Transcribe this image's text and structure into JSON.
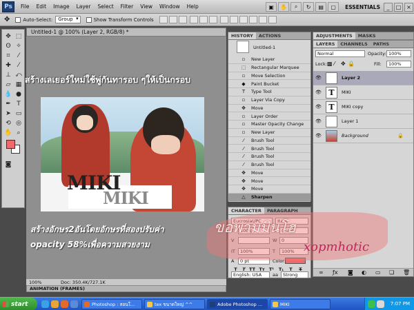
{
  "app": {
    "logo": "Ps",
    "menu": [
      "File",
      "Edit",
      "Image",
      "Layer",
      "Select",
      "Filter",
      "View",
      "Window",
      "Help"
    ],
    "workspace": "ESSENTIALS",
    "win_min": "_",
    "win_max": "□",
    "win_close": "×"
  },
  "options": {
    "auto_select_label": "Auto-Select:",
    "auto_select_value": "Group",
    "show_transform_label": "Show Transform Controls"
  },
  "document": {
    "tab_title": "Untitled-1 @ 100% (Layer 2, RGB/8) *",
    "zoom": "100%",
    "doc_size": "Doc: 350.4K/727.1K",
    "image_text_1": "MIKI",
    "image_text_2": "MIKI"
  },
  "animation_panel": {
    "tab_label": "ANIMATION (FRAMES)"
  },
  "history": {
    "tabs": [
      "HISTORY",
      "ACTIONS"
    ],
    "snapshot_label": "Untitled-1",
    "steps": [
      "New Layer",
      "Rectangular Marquee",
      "Move Selection",
      "Paint Bucket",
      "Type Tool",
      "Layer Via Copy",
      "Move",
      "Layer Order",
      "Master Opacity Change",
      "New Layer",
      "Brush Tool",
      "Brush Tool",
      "Brush Tool",
      "Brush Tool",
      "Move",
      "Move",
      "Move",
      "Sharpen"
    ],
    "selected_index": 17
  },
  "character": {
    "tabs": [
      "CHARACTER",
      "PARAGRAPH"
    ],
    "font_family": "EucrosiaUPC",
    "font_style": "Italic",
    "font_size": "100 pt",
    "leading": "(Auto)",
    "tracking": "0",
    "vertical_scale": "100%",
    "horizontal_scale": "100%",
    "baseline": "0 pt",
    "color_label": "Color:",
    "language": "English: USA",
    "antialias_label": "aa",
    "antialias": "Strong"
  },
  "adjustments": {
    "tabs": [
      "ADJUSTMENTS",
      "MASKS"
    ]
  },
  "layers": {
    "tabs": [
      "LAYERS",
      "CHANNELS",
      "PATHS"
    ],
    "blend_mode": "Normal",
    "opacity_label": "Opacity:",
    "opacity": "100%",
    "lock_label": "Lock:",
    "fill_label": "Fill:",
    "fill": "100%",
    "items": [
      {
        "name": "Layer 2",
        "thumb": "",
        "selected": true
      },
      {
        "name": "MIKI",
        "thumb": "T",
        "selected": false
      },
      {
        "name": "MIKI copy",
        "thumb": "T",
        "selected": false
      },
      {
        "name": "Layer 1",
        "thumb": "",
        "selected": false
      },
      {
        "name": "Background",
        "thumb": "",
        "selected": false
      }
    ]
  },
  "overlay": {
    "top_text": "สร้างเลเยอร์ใหม่ใช้พู่กันทารอบ ๆให้เป็นกรอบ",
    "mid_text_1": "สร้างอักษร2อันโดยอักษรที่สองปรับค่า",
    "mid_text_2": "opacity 58%เพื่อความสวยงาม",
    "watermark_thai": "ขอพามมินโฮ",
    "watermark_latin": "xopmhotic"
  },
  "taskbar": {
    "start_label": "start",
    "tasks": [
      "Photoshop : สอนใ...",
      "tex ขนาดใหญ่ ^^",
      "Adobe Photoshop ...",
      "MIKI"
    ],
    "active_task": 2,
    "clock": "7:07 PM"
  },
  "colors": {
    "foreground": "#f06a6a",
    "background": "#ffffff",
    "text_color": "#f06a6a",
    "watermark_latin": "#c2265a"
  }
}
